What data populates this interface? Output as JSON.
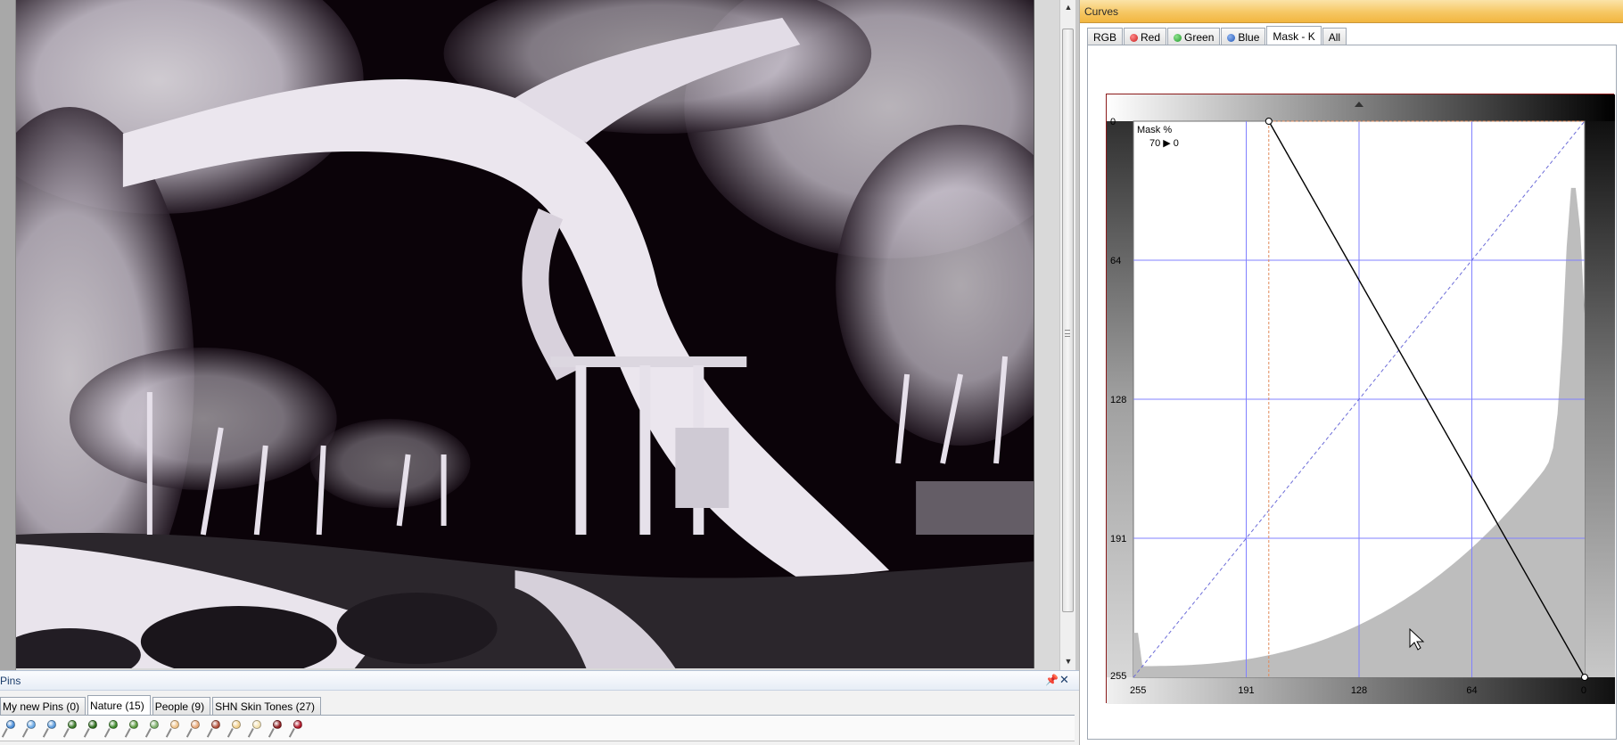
{
  "pins": {
    "title": "Pins",
    "tabs": [
      {
        "label": "My new Pins (0)"
      },
      {
        "label": "Nature (15)"
      },
      {
        "label": "People (9)"
      },
      {
        "label": "SHN Skin Tones (27)"
      }
    ],
    "active_tab": 1,
    "pin_colors": [
      "#4a8ed8",
      "#6aa9e6",
      "#5b9bdc",
      "#3c7b2a",
      "#2f6e1e",
      "#3e8a2c",
      "#5b9a3f",
      "#7db06a",
      "#f0c48a",
      "#e8a878",
      "#b2503c",
      "#f2d08c",
      "#f4e2b0",
      "#8e1f22",
      "#b0182a"
    ]
  },
  "curves": {
    "title": "Curves",
    "tabs": [
      {
        "label": "RGB",
        "dot": ""
      },
      {
        "label": "Red",
        "dot": "#d22a2a"
      },
      {
        "label": "Green",
        "dot": "#2fa83a"
      },
      {
        "label": "Blue",
        "dot": "#2f68c8"
      },
      {
        "label": "Mask - K",
        "dot": ""
      },
      {
        "label": "All",
        "dot": ""
      }
    ],
    "active_tab": 4,
    "readout_label": "Mask %",
    "readout_value": "70 ▶ 0",
    "y_ticks": [
      "0",
      "64",
      "128",
      "191",
      "255"
    ],
    "x_ticks": [
      "255",
      "191",
      "128",
      "64",
      "0"
    ],
    "grid_color": "#8080ff",
    "curve_points": [
      [
        70,
        0
      ],
      [
        0,
        100
      ]
    ]
  }
}
